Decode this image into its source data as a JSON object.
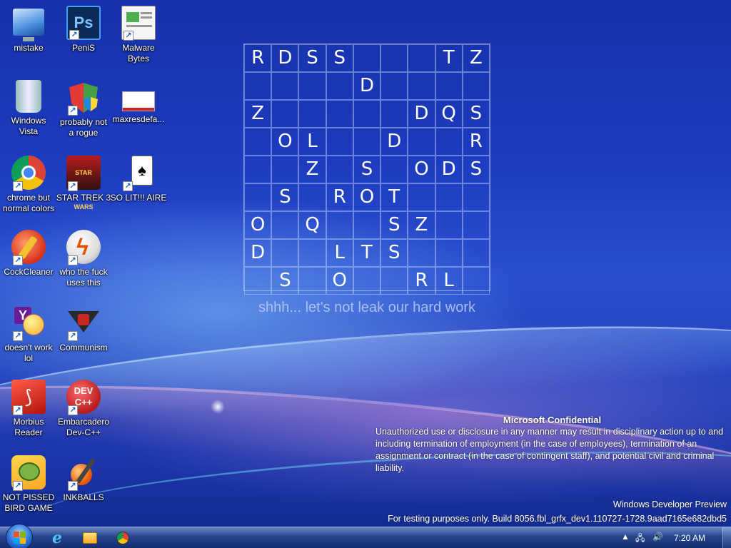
{
  "desktop_icons": [
    {
      "id": "mistake",
      "label": "mistake",
      "icon": "computer-icon"
    },
    {
      "id": "penis",
      "label": "PeniS",
      "icon": "photoshop-icon"
    },
    {
      "id": "malwarebytes",
      "label": "Malware\nBytes",
      "icon": "document-icon"
    },
    {
      "id": "windows-vista",
      "label": "Windows\nVista",
      "icon": "recycle-bin-icon"
    },
    {
      "id": "probably-not-a-rogue",
      "label": "probably not\na rogue",
      "icon": "shield-icon"
    },
    {
      "id": "maxresdefault",
      "label": "maxresdefa...",
      "icon": "image-icon",
      "thumb_text": ""
    },
    {
      "id": "chrome",
      "label": "chrome but\nnormal colors",
      "icon": "chrome-icon"
    },
    {
      "id": "star-trek-3",
      "label": "STAR TREK 3",
      "icon": "star-wars-game-icon"
    },
    {
      "id": "so-lit-aire",
      "label": "SO LIT!!! AIRE",
      "icon": "solitaire-icon"
    },
    {
      "id": "cockcleaner",
      "label": "CockCleaner",
      "icon": "ccleaner-icon"
    },
    {
      "id": "who-uses-this",
      "label": "who the fuck\nuses this",
      "icon": "flash-icon"
    },
    {
      "id": "doesnt-work",
      "label": "doesn't work\nlol",
      "icon": "yahoo-messenger-icon"
    },
    {
      "id": "communism",
      "label": "Communism",
      "icon": "emblem-icon"
    },
    {
      "id": "morbius-reader",
      "label": "Morbius\nReader",
      "icon": "adobe-reader-icon"
    },
    {
      "id": "dev-cpp",
      "label": "Embarcadero\nDev-C++",
      "icon": "devcpp-icon"
    },
    {
      "id": "not-pissed-bird",
      "label": "NOT PISSED\nBIRD GAME",
      "icon": "angry-birds-icon"
    },
    {
      "id": "inkballs",
      "label": "INKBALLS",
      "icon": "inkball-icon"
    }
  ],
  "puzzle": {
    "rows": [
      [
        "R",
        "D",
        "S",
        "S",
        "",
        "",
        "",
        "T",
        "Z"
      ],
      [
        "",
        "",
        "",
        "",
        "D",
        "",
        "",
        "",
        ""
      ],
      [
        "Z",
        "",
        "",
        "",
        "",
        "",
        "D",
        "Q",
        "S"
      ],
      [
        "",
        "O",
        "L",
        "",
        "",
        "D",
        "",
        "",
        "R"
      ],
      [
        "",
        "",
        "Z",
        "",
        "S",
        "",
        "O",
        "D",
        "S"
      ],
      [
        "",
        "S",
        "",
        "R",
        "O",
        "T",
        "",
        "",
        ""
      ],
      [
        "O",
        "",
        "Q",
        "",
        "",
        "S",
        "Z",
        "",
        ""
      ],
      [
        "D",
        "",
        "",
        "L",
        "T",
        "S",
        "",
        "",
        ""
      ],
      [
        "",
        "S",
        "",
        "O",
        "",
        "",
        "R",
        "L",
        ""
      ]
    ],
    "caption": "shhh... let's not leak our hard work"
  },
  "watermark": {
    "title": "Microsoft Confidential",
    "body": "Unauthorized use or disclosure in any manner may result in disciplinary action up to and including termination of employment (in the case of employees), termination of an assignment or contract (in the case of contingent staff), and potential civil and criminal liability.",
    "product": "Windows Developer Preview",
    "build": "For testing purposes only. Build 8056.fbl_grfx_dev1.110727-1728.9aad7165e682dbd5"
  },
  "taskbar": {
    "pinned": [
      "internet-explorer-icon",
      "file-explorer-icon",
      "chrome-icon"
    ],
    "clock": "7:20 AM",
    "tray": [
      "show-hidden-icons",
      "network-icon",
      "volume-icon"
    ]
  }
}
